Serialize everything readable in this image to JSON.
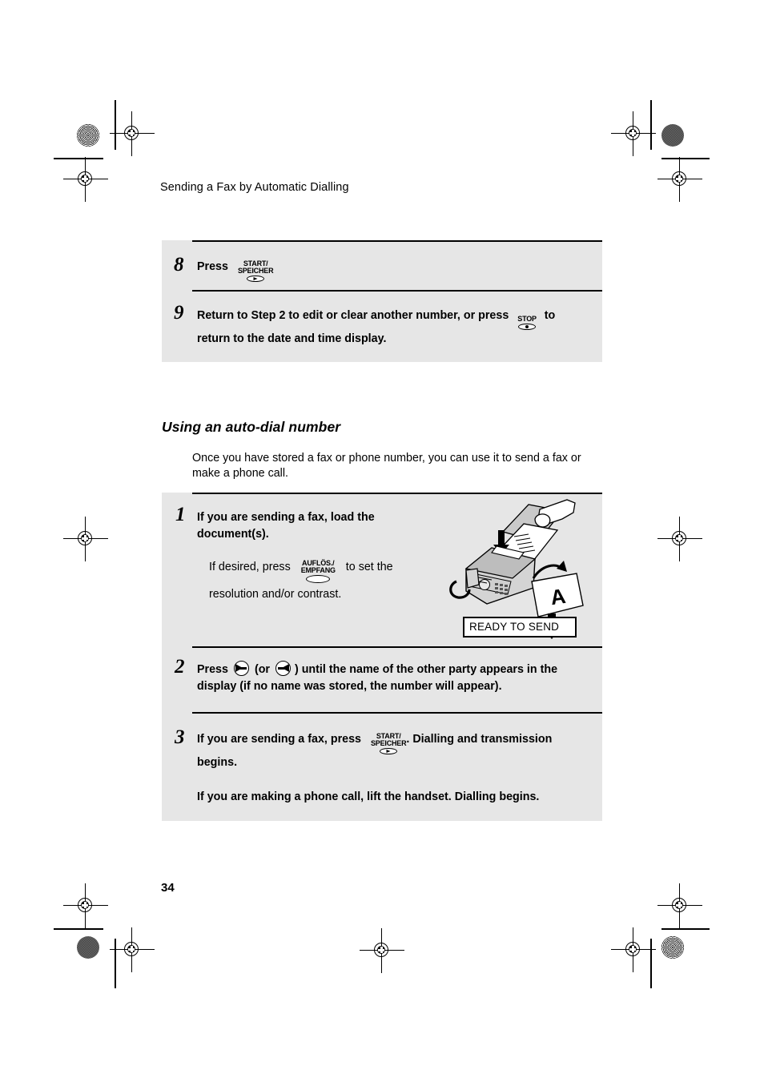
{
  "page": {
    "running_head": "Sending a Fax by Automatic Dialling",
    "page_number": "34"
  },
  "steps_top": [
    {
      "number": "8",
      "text_before": "Press",
      "key": {
        "label_line1": "START/",
        "label_line2": "SPEICHER",
        "glyph": "triangle"
      },
      "text_after": ""
    },
    {
      "number": "9",
      "text_before": "Return to Step 2 to edit or clear another number, or press",
      "key": {
        "label_line1": "",
        "label_line2": "STOP",
        "glyph": "dot"
      },
      "text_after": "to",
      "line2": "return to the date and time display."
    }
  ],
  "section": {
    "heading": "Using an auto-dial number",
    "intro": "Once you have stored a fax or phone number, you can use it to send a fax or make a phone call."
  },
  "steps_main": [
    {
      "number": "1",
      "line1": "If you are sending a fax, load the",
      "line2": "document(s).",
      "sub_before": "If desired, press",
      "sub_key": {
        "label_line1": "AUFLÖS./",
        "label_line2": "EMPFANG",
        "glyph": "none"
      },
      "sub_after": "to set the",
      "sub_line2": "resolution and/or contrast."
    },
    {
      "number": "2",
      "text_before": "Press",
      "arrow_right": "right-arrow-key",
      "text_middle": "(or",
      "arrow_left": "left-arrow-key",
      "text_after": ") until the name of the other party appears in the",
      "line2": "display (if no name was stored, the number will appear)."
    },
    {
      "number": "3",
      "text_before": "If you are sending a fax, press",
      "key": {
        "label_line1": "START/",
        "label_line2": "SPEICHER",
        "glyph": "triangle"
      },
      "text_after": ". Dialling and transmission",
      "line2": "begins.",
      "line3": "If you are making a phone call, lift the handset. Dialling begins."
    }
  ],
  "illustration": {
    "alt": "fax-machine-loading-document",
    "lcd_text": "READY TO SEND"
  },
  "colors": {
    "block_background": "#e6e6e6",
    "text": "#000000",
    "page_background": "#ffffff"
  }
}
